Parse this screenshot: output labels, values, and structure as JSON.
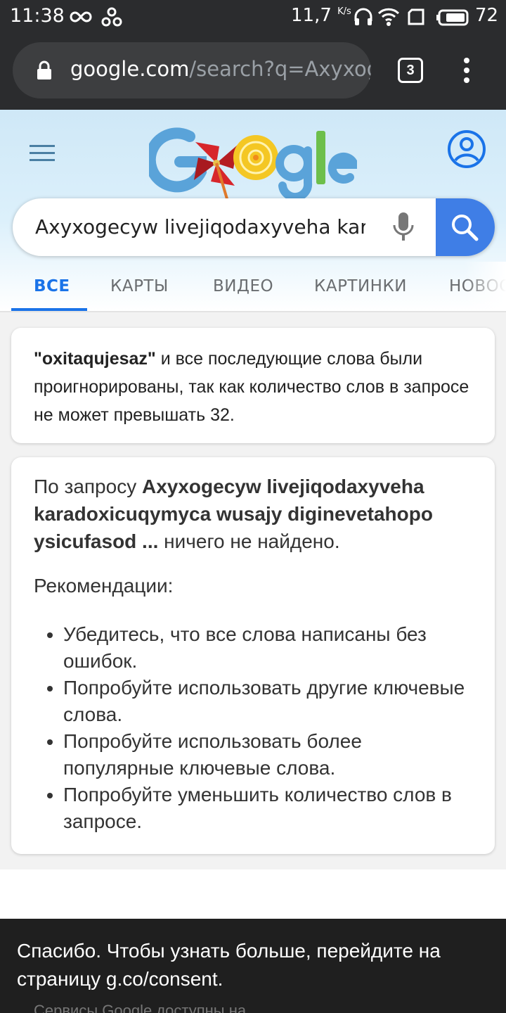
{
  "status_bar": {
    "time": "11:38",
    "speed": "11,7",
    "speed_unit": "K/s",
    "battery": "72"
  },
  "browser": {
    "url_host": "google.com",
    "url_path": "/search?q=Axyxoge",
    "tab_count": "3"
  },
  "search": {
    "query": "Axyxogecyw livejiqodaxyveha kar"
  },
  "tabs": [
    {
      "label": "ВСЕ",
      "active": true
    },
    {
      "label": "КАРТЫ"
    },
    {
      "label": "ВИДЕО"
    },
    {
      "label": "КАРТИНКИ"
    },
    {
      "label": "НОВОС"
    }
  ],
  "notice": {
    "quoted_word": "\"oxitaqujesaz\"",
    "message": " и все последующие слова были проигнорированы, так как количество слов в запросе не может превышать 32."
  },
  "no_results": {
    "prefix": "По запросу ",
    "query": "Axyxogecyw livejiqodaxyveha karadoxicuqymyca wusajy diginevetahopo ysicufasod ...",
    "suffix": " ничего не найдено.",
    "recommendations_title": "Рекомендации:",
    "recommendations": [
      "Убедитесь, что все слова написаны без ошибок.",
      "Попробуйте использовать другие ключевые слова.",
      "Попробуйте использовать более популярные ключевые слова.",
      "Попробуйте уменьшить количество слов в запросе."
    ]
  },
  "snackbar": {
    "text": "Спасибо. Чтобы узнать больше, перейдите на страницу g.co/consent.",
    "underlying_text": "Сервисы Google доступны на"
  },
  "colors": {
    "accent": "#1a73e8",
    "search_button": "#3f7ee6",
    "status_bar": "#2b2c2e"
  }
}
